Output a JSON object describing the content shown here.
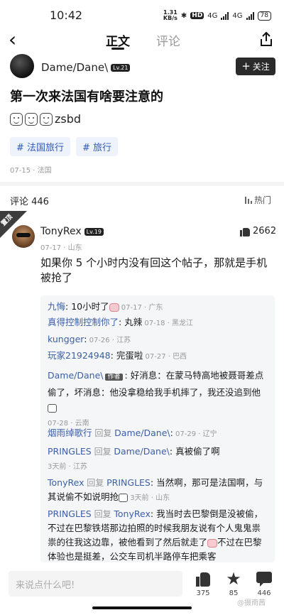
{
  "status": {
    "time": "10:42",
    "speed_value": "1.31",
    "speed_unit": "KB/s",
    "hd": "HD",
    "net1": "4G",
    "net2": "4G",
    "battery": "78"
  },
  "nav": {
    "tab_main": "正文",
    "tab_comments": "评论"
  },
  "author": {
    "name": "Dame/Dane\\",
    "level": "Lv.21",
    "follow_label": "关注"
  },
  "post": {
    "title": "第一次来法国有啥要注意的",
    "body_suffix": "zsbd",
    "tags": [
      "# 法国旅行",
      "# 旅行"
    ],
    "meta": "07-15 · 法国"
  },
  "comments_header": {
    "count_label": "评论 446",
    "sort_label": "热门"
  },
  "top_comment": {
    "pin_label": "置顶",
    "name": "TonyRex",
    "level": "Lv.19",
    "meta": "07-17 · 山东",
    "likes": "2662",
    "text": "如果你 5 个小时内没有回这个帖子，那就是手机被抢了"
  },
  "replies": [
    {
      "name": "九悔",
      "sep": ":",
      "text": " 10小时了",
      "meta": " 07-17 · 广东"
    },
    {
      "name": "真得控制控制你了",
      "sep": ":",
      "text": " 丸辣",
      "meta": " 07-18 · 黑龙江"
    },
    {
      "name": "kungger",
      "sep": ":",
      "text": "",
      "meta": " 07-26 · 江苏"
    },
    {
      "name": "玩家21924948",
      "sep": ":",
      "text": " 完蛋啦",
      "meta": " 07-27 · 巴西"
    },
    {
      "name": "Dame/Dane\\",
      "tag": "作者",
      "sep": ":",
      "text": " 好消息：在蒙马特高地被聂哥差点偷了，坏消息：他没拿稳给我手机摔了，我还没追到他",
      "meta": " 07-28 · 云南"
    },
    {
      "name": "烟雨绰歌行",
      "reply_word": " 回复 ",
      "target": "Dame/Dane\\",
      "sep": ":",
      "text": "",
      "meta": " 07-29 · 辽宁"
    },
    {
      "name": "PRINGLES",
      "reply_word": " 回复 ",
      "target": "Dame/Dane\\",
      "sep": ":",
      "text": " 真被偷了啊",
      "meta": "3天前 · 江苏"
    },
    {
      "name": "TonyRex",
      "reply_word": " 回复 ",
      "target": "PRINGLES",
      "sep": ":",
      "text": " 当然啊，那可是法国啊，与其说偷不如说明抢",
      "meta": " 3天前 · 山东"
    },
    {
      "name": "PRINGLES",
      "reply_word": " 回复 ",
      "target": "TonyRex",
      "sep": ":",
      "text": " 我当时去巴黎倒是没被偷，不过在巴黎铁塔那边拍照的时候我朋友说有个人鬼鬼祟祟的往我这边靠，被他看到了然后就走了",
      "text2": "不过在巴黎体验也是挺差，公交车司机半路停车把乘客"
    }
  ],
  "bottom": {
    "placeholder": "来说点什么吧!",
    "likes": "375",
    "stars": "85",
    "comments": "446"
  },
  "watermark": "@摄南茜",
  "colors": {
    "link": "#3a5fa8",
    "tag_bg": "#eef2fb",
    "tag_text": "#2f5bb7"
  }
}
